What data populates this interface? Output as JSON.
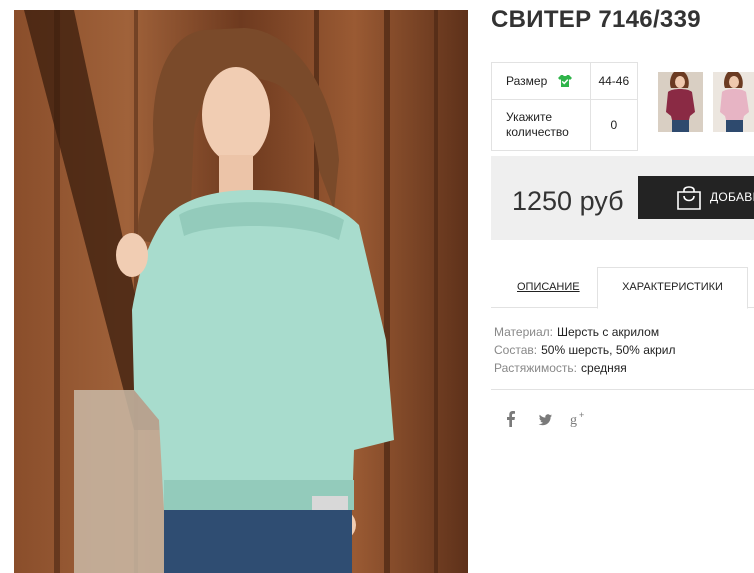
{
  "product": {
    "title": "СВИТЕР 7146/339"
  },
  "options": {
    "size_label": "Размер",
    "size_value": "44-46",
    "quantity_label_line1": "Укажите",
    "quantity_label_line2": "количество",
    "quantity_value": "0"
  },
  "purchase": {
    "price": "1250 руб",
    "buy_label": "ДОБАВИТЬ"
  },
  "tabs": {
    "description": "ОПИСАНИЕ",
    "characteristics": "ХАРАКТЕРИСТИКИ",
    "active": "characteristics"
  },
  "specs": [
    {
      "key": "Материал:",
      "value": "Шерсть с акрилом"
    },
    {
      "key": "Состав:",
      "value": "50% шерсть, 50% акрил"
    },
    {
      "key": "Растяжимость:",
      "value": "средняя"
    }
  ],
  "social": {
    "icons": [
      "facebook-icon",
      "twitter-icon",
      "google-plus-icon"
    ]
  },
  "colors": {
    "accent_green": "#2fb44a",
    "button_dark": "#232323",
    "price_bg": "#efefef",
    "sweater_mint": "#a8dccd"
  }
}
